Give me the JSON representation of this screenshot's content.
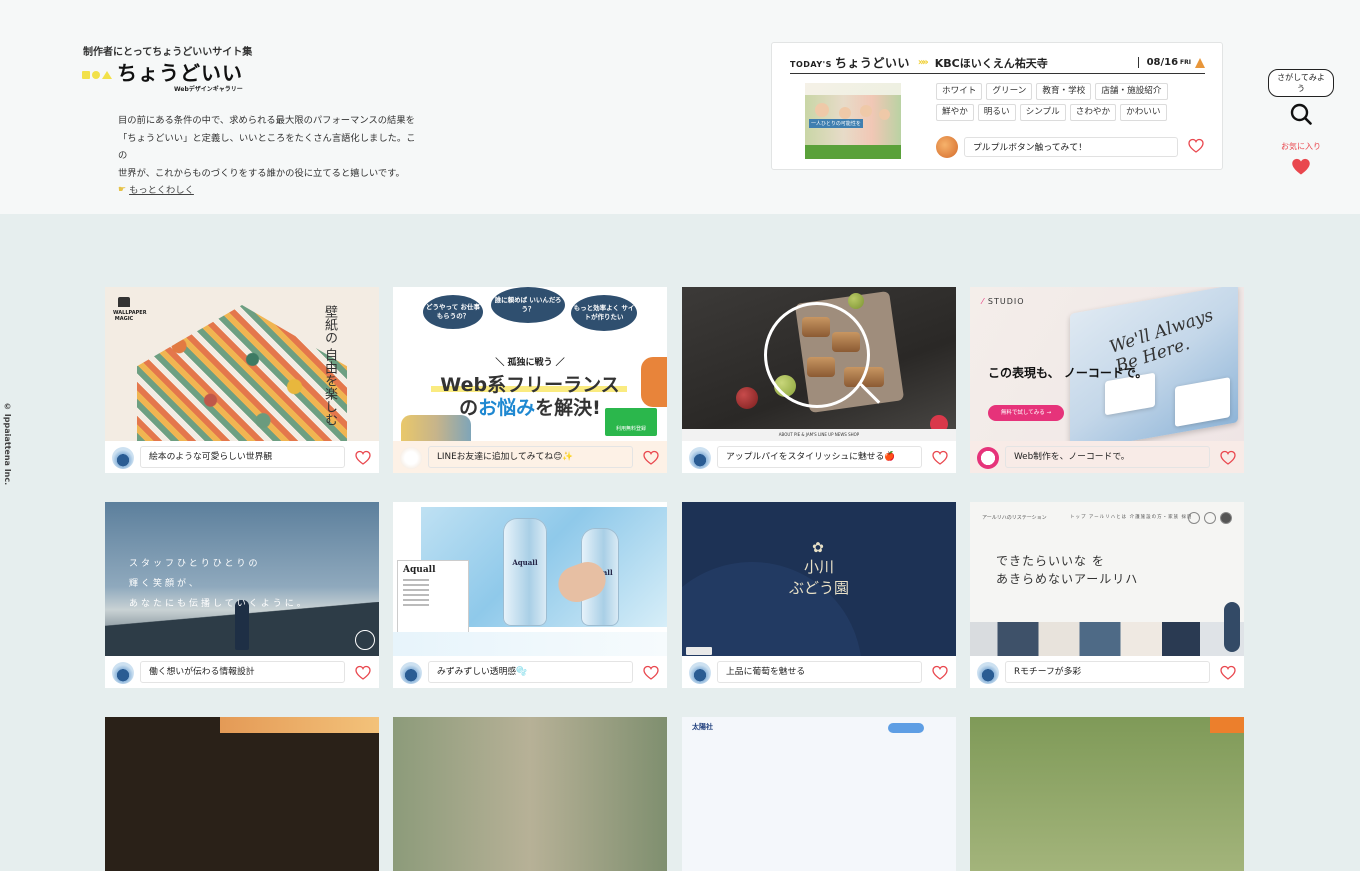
{
  "header": {
    "tagline": "制作者にとってちょうどいいサイト集",
    "logo_text": "ちょうどいい",
    "logo_sub": "Webデザインギャラリー",
    "intro_lines": [
      "目の前にある条件の中で、求められる最大限のパフォーマンスの結果を",
      "「ちょうどいい」と定義し、いいところをたくさん言語化しました。この",
      "世界が、これからものづくりをする誰かの役に立てると嬉しいです。"
    ],
    "more_link": "もっとくわしく"
  },
  "today": {
    "label_prefix": "TODAY'S",
    "label_main": "ちょうどいい",
    "arrows": "»»",
    "site_name": "KBCほいくえん祐天寺",
    "date": "08/16",
    "day": "FRI",
    "thumb_title": "一人ひとりの可能性を",
    "tags": [
      "ホワイト",
      "グリーン",
      "教育・学校",
      "店舗・施設紹介",
      "鮮やか",
      "明るい",
      "シンプル",
      "さわやか",
      "かわいい"
    ],
    "comment": "プルプルボタン触ってみて！"
  },
  "search": {
    "bubble": "さがしてみよう",
    "fav_label": "お気に入り"
  },
  "copyright": "© Ippaiattena Inc.",
  "colors": {
    "accent_yellow": "#f2e14a",
    "heart_red": "#e9474e",
    "bg": "#e6eeee"
  },
  "cards": [
    {
      "caption": "絵本のような可愛らしい世界観",
      "thumb_vert": "壁紙の 自由を楽しむ",
      "thumb_brand": "WALLPAPER MAGIC"
    },
    {
      "caption": "LINEお友達に追加してみてね😊✨",
      "thumb_bubbles": [
        "どうやって お仕事もらうの？",
        "誰に頼めば いいんだろう？",
        "もっと効率よく サイトが作りたい"
      ],
      "thumb_head": "＼ 孤独に戦う ／",
      "thumb_big1": "Web系フリーランス",
      "thumb_big2_pre": "の",
      "thumb_big2_em": "お悩み",
      "thumb_big2_post": "を解決!",
      "thumb_btn": "利用無料登録"
    },
    {
      "caption": "アップルパイをスタイリッシュに魅せる🍎",
      "thumb_nav": "ABOUT  PIE & JAM'S  LINE UP  NEWS  SHOP"
    },
    {
      "caption": "Web制作を、ノーコードで。",
      "thumb_logo": "STUDIO",
      "thumb_head": "この表現も、 ノーコードで。",
      "thumb_btn": "無料で試してみる →",
      "thumb_script": "We'll Always Be Here."
    },
    {
      "caption": "働く想いが伝わる情報設計",
      "thumb_lines": [
        "スタッフひとりひとりの",
        "輝く笑顔が、",
        "あなたにも伝播していくように。"
      ]
    },
    {
      "caption": "みずみずしい透明感🫧",
      "thumb_brand": "Aquall"
    },
    {
      "caption": "上品に葡萄を魅せる",
      "thumb_name1": "小川",
      "thumb_name2": "ぶどう園"
    },
    {
      "caption": "Rモチーフが多彩",
      "thumb_logo": "アールリハのリステーション",
      "thumb_nav": "トップ  アールリハとは  介護施設の方・家族  採用",
      "thumb_head1": "できたらいいな を",
      "thumb_head2": "あきらめないアールリハ"
    },
    {
      "caption": ""
    },
    {
      "caption": ""
    },
    {
      "caption": "",
      "thumb_logo": "太陽社"
    },
    {
      "caption": ""
    }
  ]
}
